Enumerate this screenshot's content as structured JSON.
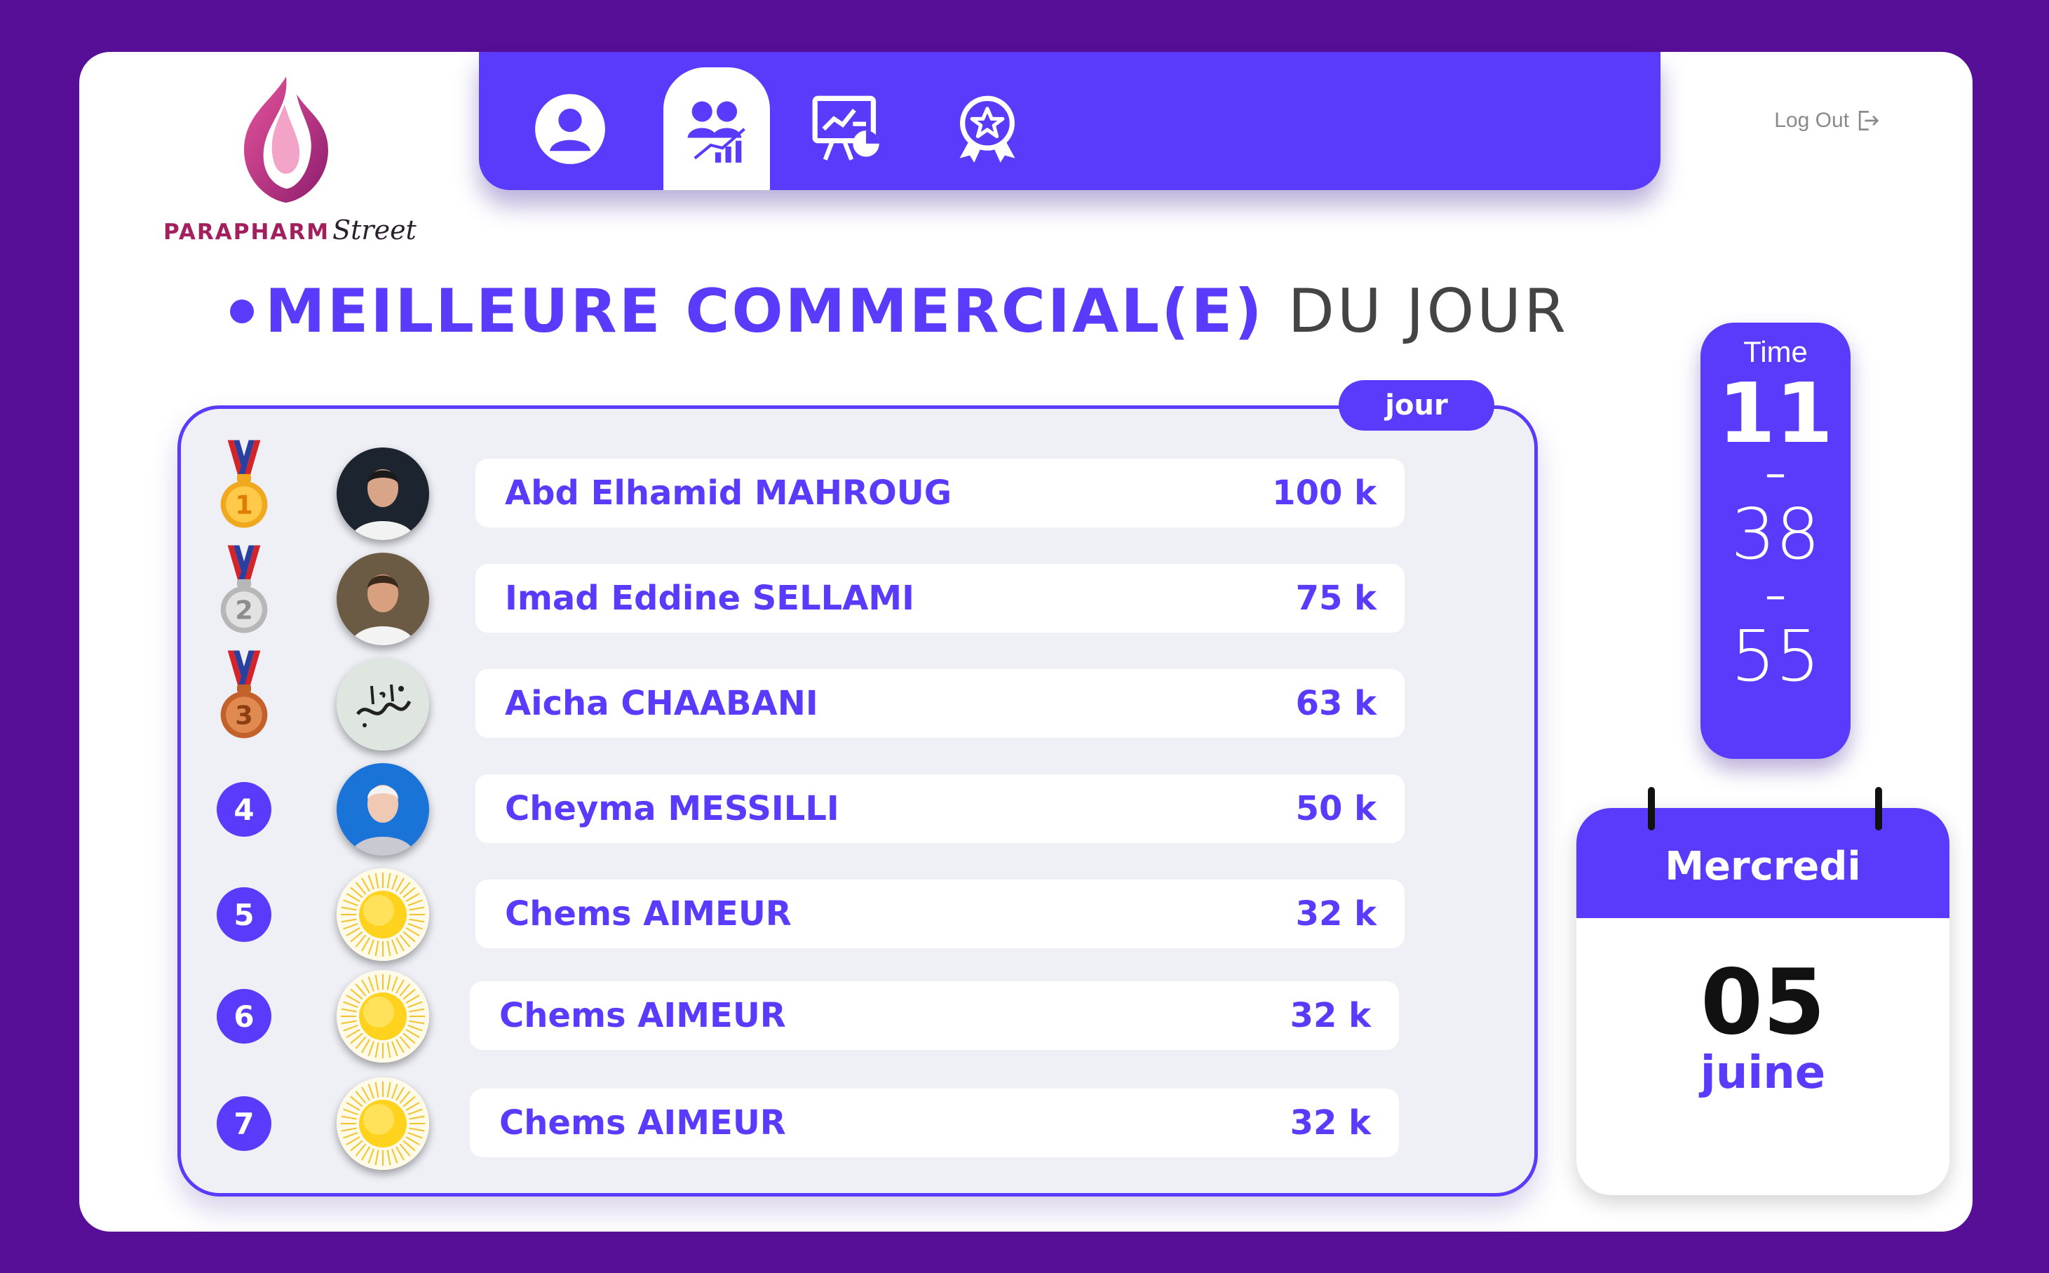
{
  "brand": {
    "name_main": "PARAPHARM",
    "name_script": "Street"
  },
  "nav": {
    "items": [
      {
        "icon": "user-icon",
        "active": false
      },
      {
        "icon": "team-performance-icon",
        "active": true
      },
      {
        "icon": "presentation-chart-icon",
        "active": false
      },
      {
        "icon": "award-badge-icon",
        "active": false
      }
    ],
    "logout_label": "Log Out"
  },
  "heading": {
    "bold": "MEILLEURE COMMERCIAL(E)",
    "light": "DU JOUR"
  },
  "leaderboard": {
    "period": "jour",
    "rows": [
      {
        "rank": "1",
        "medal": "gold",
        "avatar": "photo",
        "name": "Abd Elhamid MAHROUG",
        "value": "100 k"
      },
      {
        "rank": "2",
        "medal": "silver",
        "avatar": "photo",
        "name": "Imad Eddine SELLAMI",
        "value": "75 k"
      },
      {
        "rank": "3",
        "medal": "bronze",
        "avatar": "calligraphy",
        "name": "Aicha CHAABANI",
        "value": "63 k"
      },
      {
        "rank": "4",
        "medal": null,
        "avatar": "photo",
        "name": "Cheyma MESSILLI",
        "value": "50 k"
      },
      {
        "rank": "5",
        "medal": null,
        "avatar": "sun",
        "name": "Chems AIMEUR",
        "value": "32 k"
      },
      {
        "rank": "6",
        "medal": null,
        "avatar": "sun",
        "name": "Chems AIMEUR",
        "value": "32 k"
      },
      {
        "rank": "7",
        "medal": null,
        "avatar": "sun",
        "name": "Chems AIMEUR",
        "value": "32 k"
      }
    ]
  },
  "time": {
    "label": "Time",
    "hours": "11",
    "minutes": "38",
    "seconds": "55",
    "separator": "–"
  },
  "calendar": {
    "weekday": "Mercredi",
    "day": "05",
    "month": "juine"
  },
  "colors": {
    "accent": "#5b3bfb",
    "background": "#560f96",
    "panel": "#eff0f6",
    "brand": "#a3205e"
  }
}
